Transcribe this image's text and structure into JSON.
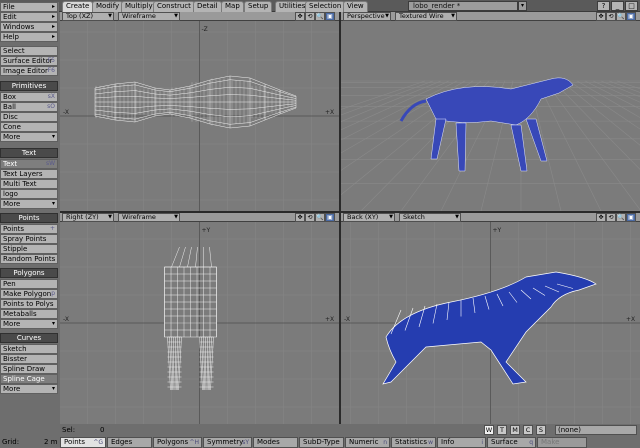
{
  "tabs": [
    "Create",
    "Modify",
    "Multiply",
    "Construct",
    "Detail",
    "Map",
    "Setup",
    "Utilities",
    "Selection",
    "View"
  ],
  "active_tab": "Create",
  "object_name": "lobo_render *",
  "window_buttons": [
    "?",
    "_",
    "□"
  ],
  "sidebar": {
    "menus": [
      {
        "label": "File"
      },
      {
        "label": "Edit"
      },
      {
        "label": "Windows"
      },
      {
        "label": "Help"
      }
    ],
    "tools": [
      {
        "label": "Select"
      },
      {
        "label": "Surface Editor",
        "key": "F5"
      },
      {
        "label": "Image Editor",
        "key": "F6"
      }
    ],
    "sections": [
      {
        "title": "Primitives",
        "items": [
          {
            "label": "Box",
            "key": "sX"
          },
          {
            "label": "Ball",
            "key": "sO"
          },
          {
            "label": "Disc"
          },
          {
            "label": "Cone"
          },
          {
            "label": "More",
            "more": true
          }
        ]
      },
      {
        "title": "Text",
        "items": [
          {
            "label": "Text",
            "key": "sW",
            "active": true
          },
          {
            "label": "Text Layers"
          },
          {
            "label": "Multi Text"
          },
          {
            "label": "logo"
          },
          {
            "label": "More",
            "more": true
          }
        ]
      },
      {
        "title": "Points",
        "items": [
          {
            "label": "Points",
            "key": "+"
          },
          {
            "label": "Spray Points"
          },
          {
            "label": "Stipple"
          },
          {
            "label": "Random Points"
          }
        ]
      },
      {
        "title": "Polygons",
        "items": [
          {
            "label": "Pen"
          },
          {
            "label": "Make Polygon",
            "key": "p"
          },
          {
            "label": "Points to Polys"
          },
          {
            "label": "Metaballs"
          },
          {
            "label": "More",
            "more": true
          }
        ]
      },
      {
        "title": "Curves",
        "items": [
          {
            "label": "Sketch"
          },
          {
            "label": "Bisster"
          },
          {
            "label": "Spline Draw"
          },
          {
            "label": "Spline Cage",
            "active": true
          },
          {
            "label": "More",
            "more": true
          }
        ]
      }
    ]
  },
  "viewports": [
    {
      "view": "Top",
      "axes": "(XZ)",
      "mode": "Wireframe",
      "type": "top"
    },
    {
      "view": "Perspective",
      "axes": "",
      "mode": "Textured Wire",
      "type": "persp"
    },
    {
      "view": "Right",
      "axes": "(ZY)",
      "mode": "Wireframe",
      "type": "right"
    },
    {
      "view": "Back",
      "axes": "(XY)",
      "mode": "Sketch",
      "type": "back"
    }
  ],
  "viewport_icons": [
    "✥",
    "⟲",
    "🔍",
    "▣"
  ],
  "axis_labels": {
    "top_center": "-Z",
    "bottom_center": "+Z",
    "left": "-X",
    "right": "+X",
    "vertical_top": "+Y"
  },
  "status": {
    "sel_label": "Sel:",
    "sel_value": "0",
    "grid_label": "Grid:",
    "grid_value": "2 m",
    "mode_buttons": [
      "W",
      "T",
      "M",
      "C",
      "S"
    ],
    "mode_active": "W",
    "surface_dropdown": "(none)"
  },
  "bottom_bar": [
    {
      "label": "Points",
      "key": "^G",
      "active": true
    },
    {
      "label": "Edges",
      "key": ""
    },
    {
      "label": "Polygons",
      "key": "^H"
    },
    {
      "label": "Symmetry",
      "key": "sY"
    },
    {
      "label": "Modes",
      "key": ""
    },
    {
      "label": "SubD-Type",
      "key": ""
    },
    {
      "label": "Numeric",
      "key": "n"
    },
    {
      "label": "Statistics",
      "key": "w"
    },
    {
      "label": "Info",
      "key": "i"
    },
    {
      "label": "Surface",
      "key": "q"
    },
    {
      "label": "Make",
      "key": "",
      "disabled": true
    }
  ],
  "colors": {
    "mesh_blue": "#3040b0",
    "mesh_wire": "#e8e8ff",
    "grid_line": "#8a8a8a",
    "viewport_bg": "#7b7b7b"
  }
}
